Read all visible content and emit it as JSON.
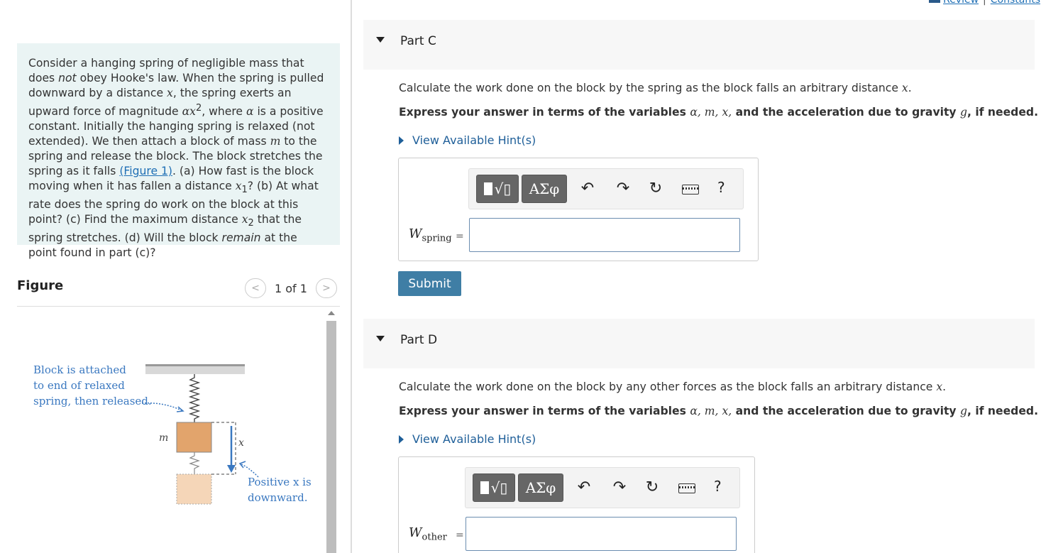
{
  "top_links": {
    "review": "Review",
    "constants": "Constants",
    "separator": "|"
  },
  "problem": {
    "t1": "Consider a hanging spring of negligible mass that does ",
    "t2": "not",
    "t3": " obey Hooke's law. When the spring is pulled downward by a distance ",
    "t4": "x",
    "t5": ", the spring exerts an upward force of magnitude ",
    "t6": "αx",
    "t6sup": "2",
    "t7": ", where ",
    "t8": "α",
    "t9": " is a positive constant. Initially the hanging spring is relaxed (not extended). We then attach a block of mass ",
    "t10": "m",
    "t11": " to the spring and release the block. The block stretches the spring as it falls ",
    "link": "(Figure 1)",
    "t12": ". (a) How fast is the block moving when it has fallen a distance ",
    "t13": "x",
    "t13sub": "1",
    "t14": "? (b) At what rate does the spring do work on the block at this point? (c) Find the maximum distance ",
    "t15": "x",
    "t15sub": "2",
    "t16": " that the spring stretches. (d) Will the block ",
    "t17": "remain",
    "t18": " at the point found in part (c)?"
  },
  "figure": {
    "title": "Figure",
    "count": "1 of 1",
    "prev": "<",
    "next": ">",
    "caption1": "Block is attached",
    "caption2": "to end of relaxed",
    "caption3": "spring, then released.",
    "mass_label": "m",
    "x_label": "x",
    "pos1": "Positive x is",
    "pos2": "downward.",
    "colors": {
      "block": "#e2a46c",
      "block_ghost": "#f5d6b8",
      "arrow": "#3a78c0",
      "caption": "#3a78c0"
    }
  },
  "parts": [
    {
      "title": "Part C",
      "question": "Calculate the work done on the block by the spring as the block falls an arbitrary distance ",
      "q_var": "x",
      "q_end": ".",
      "inst_a": "Express your answer in terms of the variables ",
      "inst_vars": "α, m, x,",
      "inst_b": " and the acceleration due to gravity ",
      "inst_g": "g",
      "inst_c": ", if needed.",
      "hint": "View Available Hint(s)",
      "label_main": "W",
      "label_sub": "spring",
      "eq": "=",
      "value": ""
    },
    {
      "title": "Part D",
      "question": "Calculate the work done on the block by any other forces as the block falls an arbitrary distance ",
      "q_var": "x",
      "q_end": ".",
      "inst_a": "Express your answer in terms of the variables ",
      "inst_vars": "α, m, x,",
      "inst_b": " and the acceleration due to gravity ",
      "inst_g": "g",
      "inst_c": ", if needed.",
      "hint": "View Available Hint(s)",
      "label_main": "W",
      "label_sub": "other",
      "eq": "=",
      "value": ""
    }
  ],
  "toolbar": {
    "templates_icon": "√▯",
    "symbols_label": "ΑΣφ",
    "undo_icon": "↶",
    "redo_icon": "↷",
    "reset_icon": "↻",
    "help_label": "?"
  },
  "submit_label": "Submit"
}
